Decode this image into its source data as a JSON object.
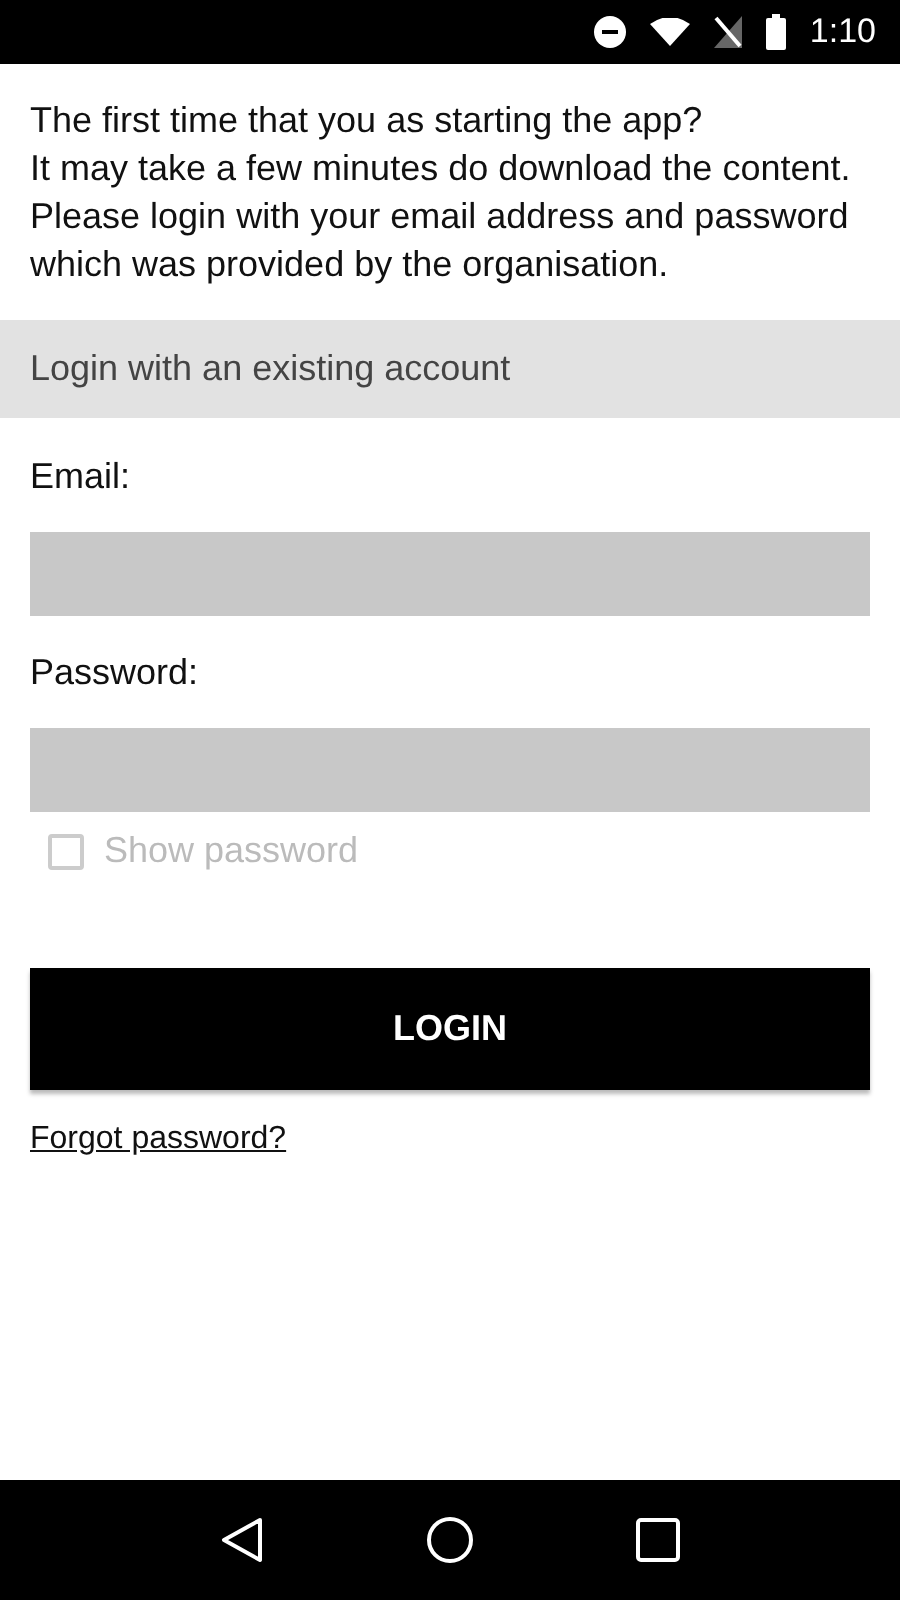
{
  "status_bar": {
    "time": "1:10"
  },
  "intro": [
    "The first time that you as starting the app?",
    "It may take a few minutes do download the content. Please login with your email address and password which was provided by the organisation."
  ],
  "section_header": "Login with an existing account",
  "fields": [
    {
      "label": "Email:"
    },
    {
      "label": "Password:"
    }
  ],
  "show_password": {
    "label": "Show password",
    "checked": false,
    "disabled": true
  },
  "login_button": "LOGIN",
  "forgot_link": "Forgot password?"
}
